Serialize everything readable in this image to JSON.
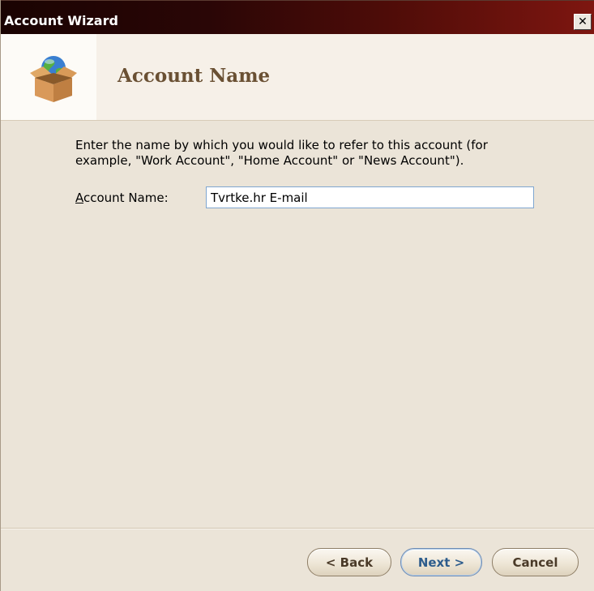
{
  "window": {
    "title": "Account Wizard",
    "close_glyph": "✕"
  },
  "header": {
    "icon": "globe-in-box-icon",
    "title": "Account Name"
  },
  "content": {
    "description": "Enter the name by which you would like to refer to this account (for example, \"Work Account\", \"Home Account\" or \"News Account\").",
    "field_label_accesskey": "A",
    "field_label_rest": "ccount Name:",
    "account_name_value": "Tvrtke.hr E-mail"
  },
  "footer": {
    "back_label": "< Back",
    "next_label": "Next >",
    "cancel_label": "Cancel"
  },
  "colors": {
    "titlebar_start": "#1a0302",
    "titlebar_end": "#7e1610",
    "dialog_bg": "#ebe4d8",
    "header_title": "#6a5033",
    "next_text": "#2d5c8c"
  }
}
